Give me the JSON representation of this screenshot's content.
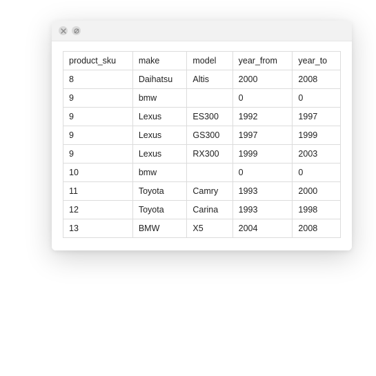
{
  "table": {
    "columns": [
      "product_sku",
      "make",
      "model",
      "year_from",
      "year_to"
    ],
    "rows": [
      {
        "product_sku": "8",
        "make": "Daihatsu",
        "model": "Altis",
        "year_from": "2000",
        "year_to": "2008"
      },
      {
        "product_sku": "9",
        "make": "bmw",
        "model": "",
        "year_from": "0",
        "year_to": "0"
      },
      {
        "product_sku": "9",
        "make": "Lexus",
        "model": "ES300",
        "year_from": "1992",
        "year_to": "1997"
      },
      {
        "product_sku": "9",
        "make": "Lexus",
        "model": "GS300",
        "year_from": "1997",
        "year_to": "1999"
      },
      {
        "product_sku": "9",
        "make": "Lexus",
        "model": "RX300",
        "year_from": "1999",
        "year_to": "2003"
      },
      {
        "product_sku": "10",
        "make": "bmw",
        "model": "",
        "year_from": "0",
        "year_to": "0"
      },
      {
        "product_sku": "11",
        "make": "Toyota",
        "model": "Camry",
        "year_from": "1993",
        "year_to": "2000"
      },
      {
        "product_sku": "12",
        "make": "Toyota",
        "model": "Carina",
        "year_from": "1993",
        "year_to": "1998"
      },
      {
        "product_sku": "13",
        "make": "BMW",
        "model": "X5",
        "year_from": "2004",
        "year_to": "2008"
      }
    ]
  }
}
